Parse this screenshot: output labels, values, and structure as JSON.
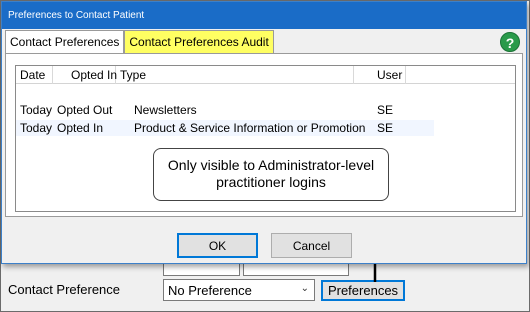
{
  "dialog": {
    "title": "Preferences to Contact Patient",
    "tabs": [
      {
        "label": "Contact Preferences",
        "active": false
      },
      {
        "label": "Contact Preferences Audit",
        "active": true
      }
    ],
    "help_icon": "help-icon"
  },
  "audit_table": {
    "columns": [
      "Date",
      "Opted In",
      "Type",
      "User"
    ],
    "rows": [
      {
        "date": "Today",
        "opted_in": "Opted Out",
        "type": "Newsletters",
        "user": "SE"
      },
      {
        "date": "Today",
        "opted_in": "Opted In",
        "type": "Product & Service Information or Promotion",
        "user": "SE"
      }
    ]
  },
  "callout": {
    "text": "Only visible to Administrator-level practitioner logins"
  },
  "buttons": {
    "ok": "OK",
    "cancel": "Cancel"
  },
  "background": {
    "contact_preference_label": "Contact Preference",
    "contact_preference_value": "No Preference",
    "preferences_button": "Preferences"
  },
  "colors": {
    "titlebar": "#1a6cc7",
    "active_tab": "#ffff62",
    "help_icon": "#2a9a4a",
    "focus_border": "#0078d7"
  }
}
